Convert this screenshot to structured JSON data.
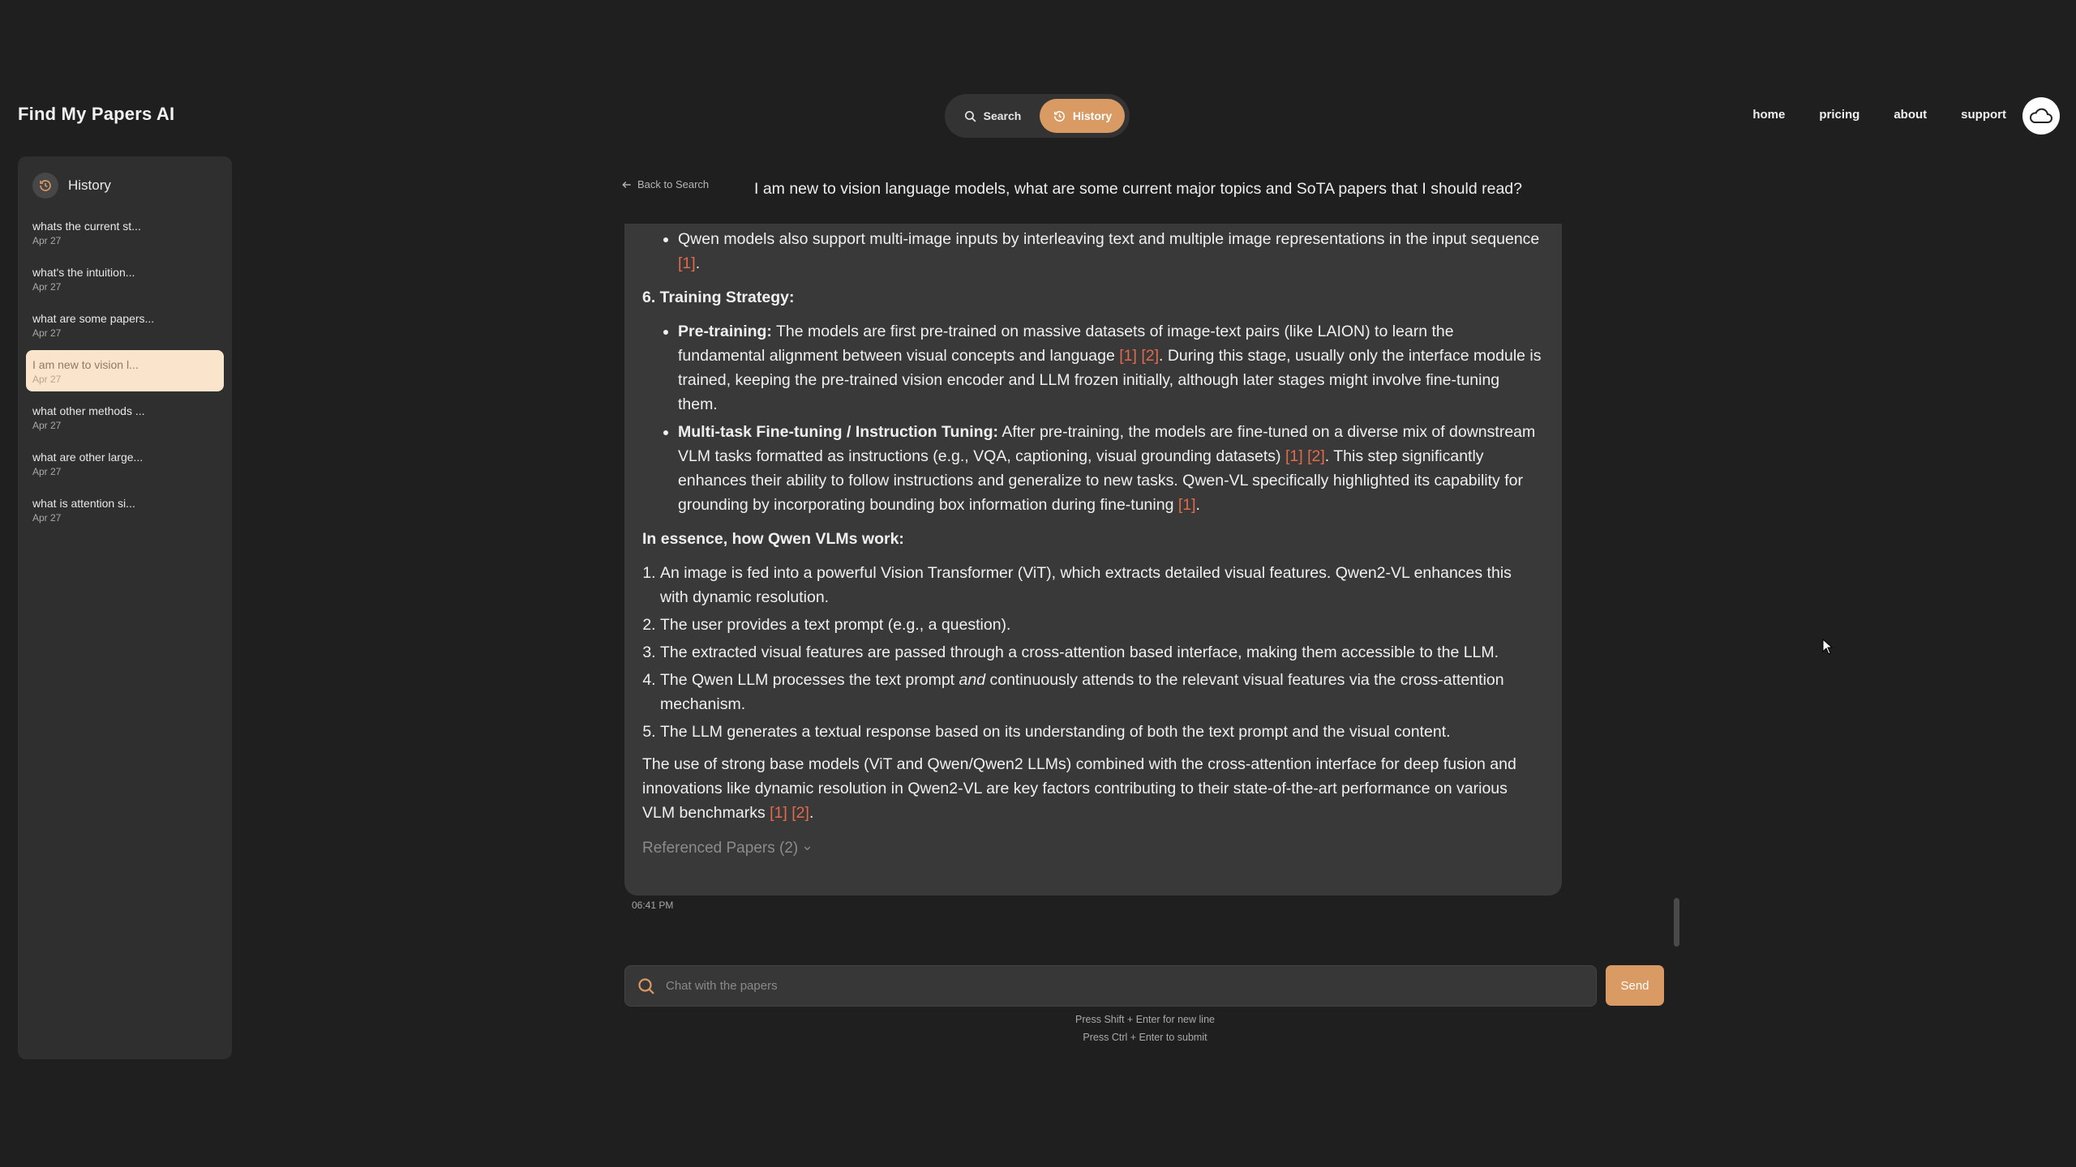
{
  "app": {
    "title": "Find My Papers AI"
  },
  "mode_switch": {
    "search_label": "Search",
    "history_label": "History"
  },
  "nav": {
    "home": "home",
    "pricing": "pricing",
    "about": "about",
    "support": "support"
  },
  "sidebar": {
    "title": "History",
    "items": [
      {
        "title": "whats the current st...",
        "date": "Apr 27"
      },
      {
        "title": "what's the intuition...",
        "date": "Apr 27"
      },
      {
        "title": "what are some papers...",
        "date": "Apr 27"
      },
      {
        "title": "I am new to vision l...",
        "date": "Apr 27",
        "active": true
      },
      {
        "title": "what other methods ...",
        "date": "Apr 27"
      },
      {
        "title": "what are other large...",
        "date": "Apr 27"
      },
      {
        "title": "what is attention si...",
        "date": "Apr 27"
      }
    ]
  },
  "conversation": {
    "back_label": "Back to Search",
    "question": "I am new to vision language models, what are some current major topics and SoTA papers that I should read?",
    "answer": {
      "qwen_multi_image": {
        "text": "Qwen models also support multi-image inputs by interleaving text and multiple image representations in the input sequence ",
        "c1": "[1]",
        "end": "."
      },
      "training_heading": "6. Training Strategy:",
      "pretraining": {
        "label": "Pre-training:",
        "text_a": " The models are first pre-trained on massive datasets of image-text pairs (like LAION) to learn the fundamental alignment between visual concepts and language ",
        "c1": "[1]",
        "c2": "[2]",
        "text_b": ". During this stage, usually only the interface module is trained, keeping the pre-trained vision encoder and LLM frozen initially, although later stages might involve fine-tuning them."
      },
      "finetuning": {
        "label": "Multi-task Fine-tuning / Instruction Tuning:",
        "text_a": " After pre-training, the models are fine-tuned on a diverse mix of downstream VLM tasks formatted as instructions (e.g., VQA, captioning, visual grounding datasets) ",
        "c1": "[1]",
        "c2": "[2]",
        "text_b": ". This step significantly enhances their ability to follow instructions and generalize to new tasks. Qwen-VL specifically highlighted its capability for grounding by incorporating bounding box information during fine-tuning ",
        "c3": "[1]",
        "end": "."
      },
      "essence_heading": "In essence, how Qwen VLMs work:",
      "steps": {
        "s1": "An image is fed into a powerful Vision Transformer (ViT), which extracts detailed visual features. Qwen2-VL enhances this with dynamic resolution.",
        "s2": "The user provides a text prompt (e.g., a question).",
        "s3": "The extracted visual features are passed through a cross-attention based interface, making them accessible to the LLM.",
        "s4_a": "The Qwen LLM processes the text prompt ",
        "s4_em": "and",
        "s4_b": " continuously attends to the relevant visual features via the cross-attention mechanism.",
        "s5": "The LLM generates a textual response based on its understanding of both the text prompt and the visual content."
      },
      "closing": {
        "text": "The use of strong base models (ViT and Qwen/Qwen2 LLMs) combined with the cross-attention interface for deep fusion and innovations like dynamic resolution in Qwen2-VL are key factors contributing to their state-of-the-art performance on various VLM benchmarks ",
        "c1": "[1]",
        "c2": "[2]",
        "end": "."
      },
      "referenced_papers": "Referenced Papers (2)"
    },
    "timestamp": "06:41 PM"
  },
  "chat": {
    "placeholder": "Chat with the papers",
    "send_label": "Send",
    "hint_newline": "Press Shift + Enter for new line",
    "hint_submit": "Press Ctrl + Enter to submit"
  },
  "colors": {
    "accent": "#d99a63",
    "citation": "#e06a4a",
    "background": "#1f1f1f",
    "panel": "#393939",
    "active_history": "#fbe4cc"
  },
  "icons": [
    "search-icon",
    "history-icon",
    "cloud-icon",
    "arrow-left-icon",
    "chevron-down-icon",
    "cursor-icon"
  ]
}
